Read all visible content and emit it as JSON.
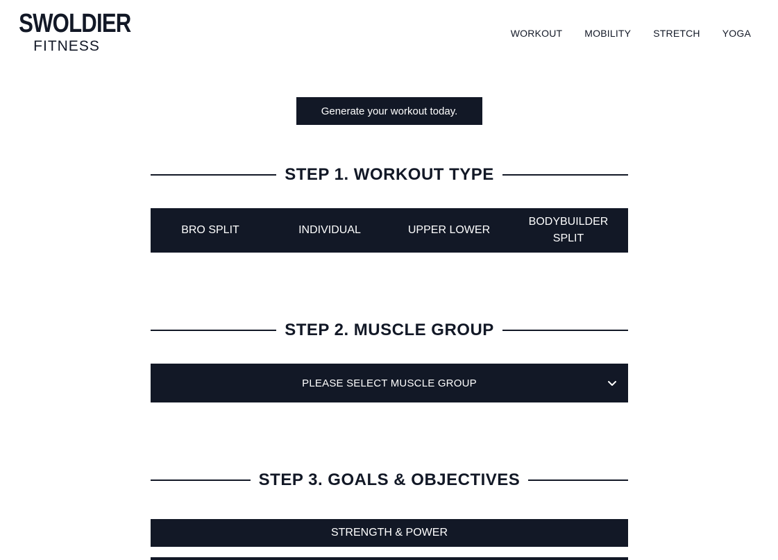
{
  "header": {
    "logo_top": "SWOLDIER",
    "logo_bottom": "FITNESS",
    "nav": [
      {
        "label": "WORKOUT"
      },
      {
        "label": "MOBILITY"
      },
      {
        "label": "STRETCH"
      },
      {
        "label": "YOGA"
      }
    ]
  },
  "cta": {
    "label": "Generate your workout today."
  },
  "step1": {
    "title": "STEP 1. WORKOUT TYPE",
    "options": [
      {
        "label": "BRO SPLIT"
      },
      {
        "label": "INDIVIDUAL"
      },
      {
        "label": "UPPER LOWER"
      },
      {
        "label": "BODYBUILDER SPLIT"
      }
    ]
  },
  "step2": {
    "title": "STEP 2. MUSCLE GROUP",
    "select_value": "PLEASE SELECT MUSCLE GROUP",
    "icon": "chevron-down-icon"
  },
  "step3": {
    "title": "STEP 3. GOALS & OBJECTIVES",
    "options": [
      {
        "label": "STRENGTH & POWER"
      }
    ]
  },
  "colors": {
    "primary": "#121826",
    "background": "#ffffff",
    "text_on_primary": "#ffffff"
  }
}
